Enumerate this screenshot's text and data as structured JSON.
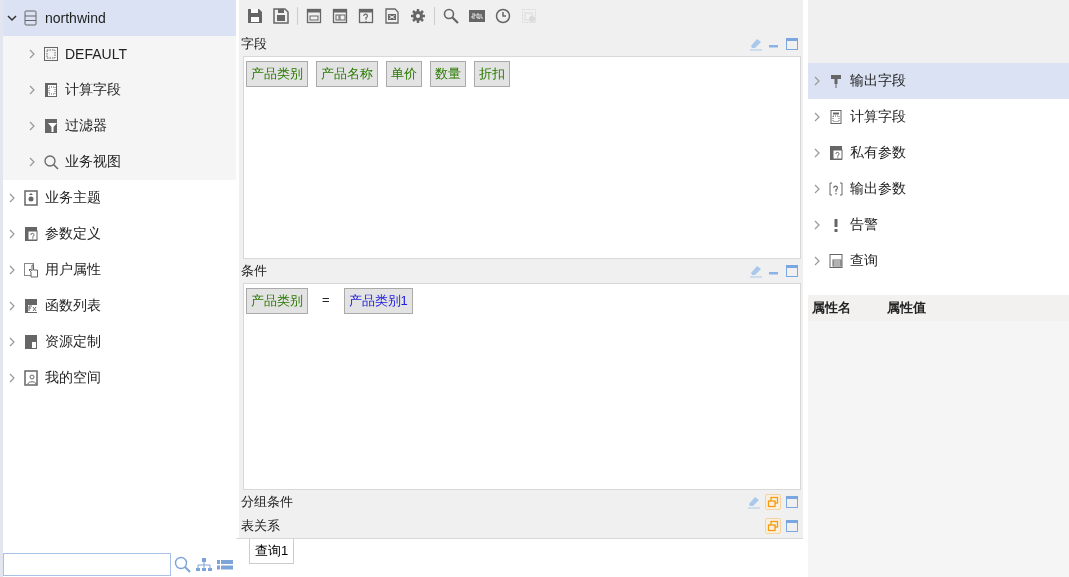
{
  "sidebar": {
    "tree": [
      {
        "label": "northwind",
        "expanded": true,
        "selected": true,
        "children": [
          {
            "label": "DEFAULT",
            "expanded": false,
            "selected": false
          },
          {
            "label": "计算字段",
            "expanded": false,
            "selected": false
          },
          {
            "label": "过滤器",
            "expanded": false,
            "selected": false
          },
          {
            "label": "业务视图",
            "expanded": false,
            "selected": false
          }
        ]
      },
      {
        "label": "业务主题",
        "expanded": false,
        "selected": false
      },
      {
        "label": "参数定义",
        "expanded": false,
        "selected": false
      },
      {
        "label": "用户属性",
        "expanded": false,
        "selected": false
      },
      {
        "label": "函数列表",
        "expanded": false,
        "selected": false
      },
      {
        "label": "资源定制",
        "expanded": false,
        "selected": false
      },
      {
        "label": "我的空间",
        "expanded": false,
        "selected": false
      }
    ]
  },
  "toolbar": [
    {
      "disabled": false
    },
    {
      "disabled": false
    },
    {
      "disabled": false
    },
    {
      "disabled": false
    },
    {
      "disabled": false
    },
    {
      "disabled": false
    },
    {
      "disabled": false
    },
    {
      "disabled": false
    },
    {
      "disabled": false
    },
    {
      "disabled": false
    },
    {
      "disabled": true
    }
  ],
  "panels": [
    {
      "title": "字段",
      "clearable": true,
      "collapsed": false,
      "items": [
        {
          "kind": "field",
          "label": "产品类别"
        },
        {
          "kind": "field",
          "label": "产品名称"
        },
        {
          "kind": "field",
          "label": "单价"
        },
        {
          "kind": "field",
          "label": "数量"
        },
        {
          "kind": "field",
          "label": "折扣"
        }
      ]
    },
    {
      "title": "条件",
      "clearable": true,
      "collapsed": false,
      "items": [
        {
          "kind": "field",
          "label": "产品类别"
        },
        {
          "kind": "operator",
          "label": "="
        },
        {
          "kind": "param",
          "label": "产品类别1"
        }
      ]
    },
    {
      "title": "分组条件",
      "clearable": true,
      "collapsed": true
    },
    {
      "title": "表关系",
      "clearable": false,
      "collapsed": true
    }
  ],
  "query_tabs": [
    {
      "label": "查询1",
      "selected": true
    }
  ],
  "outline": {
    "items": [
      {
        "label": "输出字段",
        "selected": true,
        "expanded": false
      },
      {
        "label": "计算字段",
        "selected": false,
        "expanded": false
      },
      {
        "label": "私有参数",
        "selected": false,
        "expanded": false
      },
      {
        "label": "输出参数",
        "selected": false,
        "expanded": false
      },
      {
        "label": "告警",
        "selected": false,
        "expanded": false
      },
      {
        "label": "查询",
        "selected": false,
        "expanded": false
      }
    ]
  },
  "properties": {
    "columns": [
      "属性名",
      "属性值"
    ]
  }
}
